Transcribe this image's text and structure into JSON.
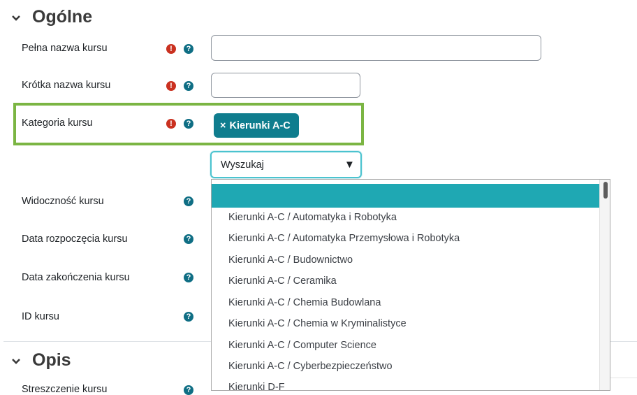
{
  "sections": {
    "general": {
      "title": "Ogólne"
    },
    "description": {
      "title": "Opis"
    }
  },
  "fields": {
    "fullname": {
      "label": "Pełna nazwa kursu",
      "value": ""
    },
    "shortname": {
      "label": "Krótka nazwa kursu",
      "value": ""
    },
    "category": {
      "label": "Kategoria kursu",
      "selected": "Kierunki A-C",
      "remove_symbol": "×"
    },
    "visibility": {
      "label": "Widoczność kursu"
    },
    "startdate": {
      "label": "Data rozpoczęcia kursu"
    },
    "enddate": {
      "label": "Data zakończenia kursu"
    },
    "idnumber": {
      "label": "ID kursu"
    },
    "summary": {
      "label": "Streszczenie kursu"
    }
  },
  "search": {
    "label": "Wyszukaj",
    "arrow": "▼"
  },
  "dropdown": {
    "highlighted": "",
    "options": [
      "Kierunki A-C / Automatyka i Robotyka",
      "Kierunki A-C / Automatyka Przemysłowa i Robotyka",
      "Kierunki A-C / Budownictwo",
      "Kierunki A-C / Ceramika",
      "Kierunki A-C / Chemia Budowlana",
      "Kierunki A-C / Chemia w Kryminalistyce",
      "Kierunki A-C / Computer Science",
      "Kierunki A-C / Cyberbezpieczeństwo",
      "Kierunki D-F"
    ]
  },
  "icons": {
    "required": "!",
    "help": "?"
  },
  "colors": {
    "required": "#ca3120",
    "help": "#0f6e84",
    "tag": "#0f7d8e",
    "highlight_border": "#7bb543",
    "option_highlight": "#1fa8b3"
  }
}
